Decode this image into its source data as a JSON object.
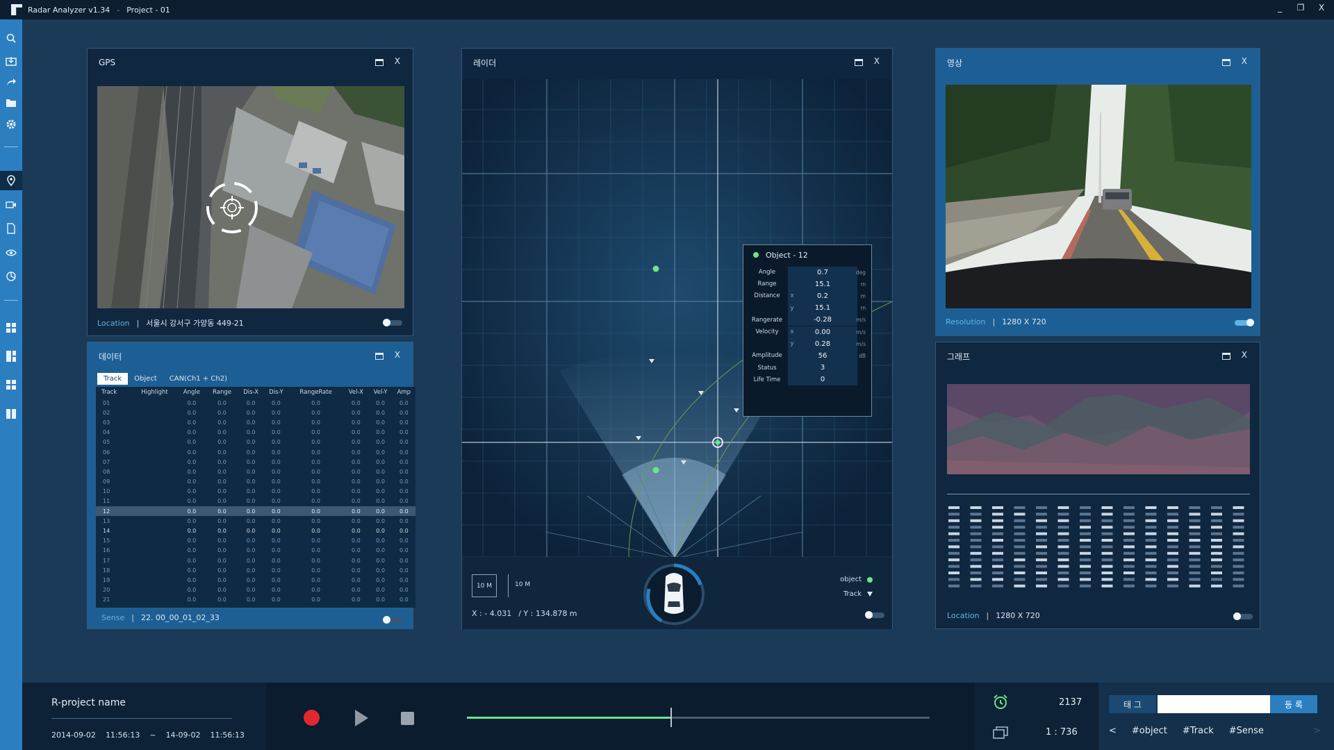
{
  "app": {
    "title": "Radar Analyzer v1.34",
    "separator": "-",
    "project": "Project - 01"
  },
  "window_controls": {
    "minimize": "_",
    "restore": "❐",
    "close": "X"
  },
  "sidebar": {
    "items": [
      "search-icon",
      "import-icon",
      "share-icon",
      "folder-icon",
      "settings-icon",
      "location-icon",
      "camera-icon",
      "document-icon",
      "eye-icon",
      "chart-icon",
      "grid-icon",
      "layout-icon",
      "tiles-icon",
      "split-icon"
    ]
  },
  "gps": {
    "title": "GPS",
    "location_label": "Location",
    "location_value": "서울시 강서구 가양동 449-21",
    "close": "X"
  },
  "data_panel": {
    "title": "데이터",
    "close": "X",
    "tabs": [
      "Track",
      "Object",
      "CAN(Ch1 + Ch2)"
    ],
    "columns": [
      "Track",
      "Highlight",
      "Angle",
      "Range",
      "Dis-X",
      "Dis-Y",
      "RangeRate",
      "Vel-X",
      "Vel-Y",
      "Amp"
    ],
    "rows": [
      "01",
      "02",
      "03",
      "04",
      "05",
      "06",
      "07",
      "08",
      "09",
      "10",
      "11",
      "12",
      "13",
      "14",
      "15",
      "16",
      "17",
      "18",
      "19",
      "20",
      "21"
    ],
    "cell_value": "0.0",
    "selected_row": "12",
    "highlight_row": "14",
    "footer_label": "Sense",
    "footer_value": "22. 00_00_01_02_33"
  },
  "radar": {
    "title": "레이더",
    "close": "X",
    "scale_box": "10 M",
    "scale_label": "10 M",
    "coord_x": "X : - 4.031",
    "coord_y": "/ Y : 134.878  m",
    "legend_object": "object",
    "legend_track": "Track",
    "object_info": {
      "title": "Object - 12",
      "rows": [
        {
          "key": "Angle",
          "sub": "",
          "value": "0.7",
          "unit": "deg"
        },
        {
          "key": "Range",
          "sub": "",
          "value": "15.1",
          "unit": "m"
        },
        {
          "key": "Distance",
          "sub": "x",
          "value": "0.2",
          "unit": "m"
        },
        {
          "key": "",
          "sub": "y",
          "value": "15.1",
          "unit": "m"
        },
        {
          "key": "Rangerate",
          "sub": "",
          "value": "-0.28",
          "unit": "m/s"
        },
        {
          "key": "Velocity",
          "sub": "x",
          "value": "0.00",
          "unit": "m/s"
        },
        {
          "key": "",
          "sub": "y",
          "value": "0.28",
          "unit": "m/s"
        },
        {
          "key": "Amplitude",
          "sub": "",
          "value": "56",
          "unit": "dB"
        },
        {
          "key": "Status",
          "sub": "",
          "value": "3",
          "unit": ""
        },
        {
          "key": "Life Time",
          "sub": "",
          "value": "0",
          "unit": ""
        }
      ]
    }
  },
  "video": {
    "title": "영상",
    "close": "X",
    "resolution_label": "Resolution",
    "resolution_value": "1280 X 720"
  },
  "graph": {
    "title": "그래프",
    "close": "X",
    "location_label": "Location",
    "location_value": "1280 X 720"
  },
  "bottom": {
    "project_name": "R-project name",
    "start_date": "2014-09-02",
    "start_time": "11:56:13",
    "tilde": "~",
    "end_date": "14-09-02",
    "end_time": "11:56:13",
    "progress": 0.44,
    "frame_count": "2137",
    "ratio": "1  :  736",
    "tag_label": "태 그",
    "tag_button": "등 록",
    "hashtags": [
      "#object",
      "#Track",
      "#Sense"
    ],
    "prev": "<",
    "next": ">"
  },
  "colors": {
    "accent": "#2b7fc0",
    "highlight": "#5fb4e6",
    "object": "#6fe38c",
    "record": "#e2282c"
  }
}
